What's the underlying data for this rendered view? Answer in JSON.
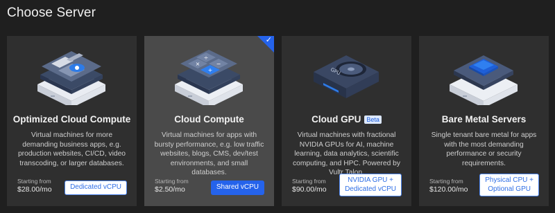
{
  "page": {
    "title": "Choose Server"
  },
  "cards": [
    {
      "title": "Optimized Cloud Compute",
      "description": "Virtual machines for more demanding business apps, e.g. production websites, CI/CD, video transcoding, or larger databases.",
      "price_label": "Starting from",
      "price": "$28.00/mo",
      "feature": "Dedicated vCPU",
      "selected": false,
      "icon": "optimized-cloud-icon"
    },
    {
      "title": "Cloud Compute",
      "description": "Virtual machines for apps with bursty performance, e.g. low traffic websites, blogs, CMS, dev/test environments, and small databases.",
      "price_label": "Starting from",
      "price": "$2.50/mo",
      "feature": "Shared vCPU",
      "selected": true,
      "icon": "cloud-compute-icon"
    },
    {
      "title": "Cloud GPU",
      "badge": "Beta",
      "description": "Virtual machines with fractional NVIDIA GPUs for AI, machine learning, data analytics, scientific computing, and HPC. Powered by Vultr Talon.",
      "price_label": "Starting from",
      "price": "$90.00/mo",
      "feature_line1": "NVIDIA GPU +",
      "feature_line2": "Dedicated vCPU",
      "selected": false,
      "icon": "gpu-icon",
      "gpu_label": "GPU"
    },
    {
      "title": "Bare Metal Servers",
      "description": "Single tenant bare metal for apps with the most demanding performance or security requirements.",
      "price_label": "Starting from",
      "price": "$120.00/mo",
      "feature_line1": "Physical CPU +",
      "feature_line2": "Optional GPU",
      "selected": false,
      "icon": "bare-metal-icon"
    }
  ],
  "colors": {
    "accent": "#2563eb",
    "card_bg": "#2f2f2f",
    "card_selected_bg": "#4a4a4a"
  },
  "selected_indicator": "✓"
}
